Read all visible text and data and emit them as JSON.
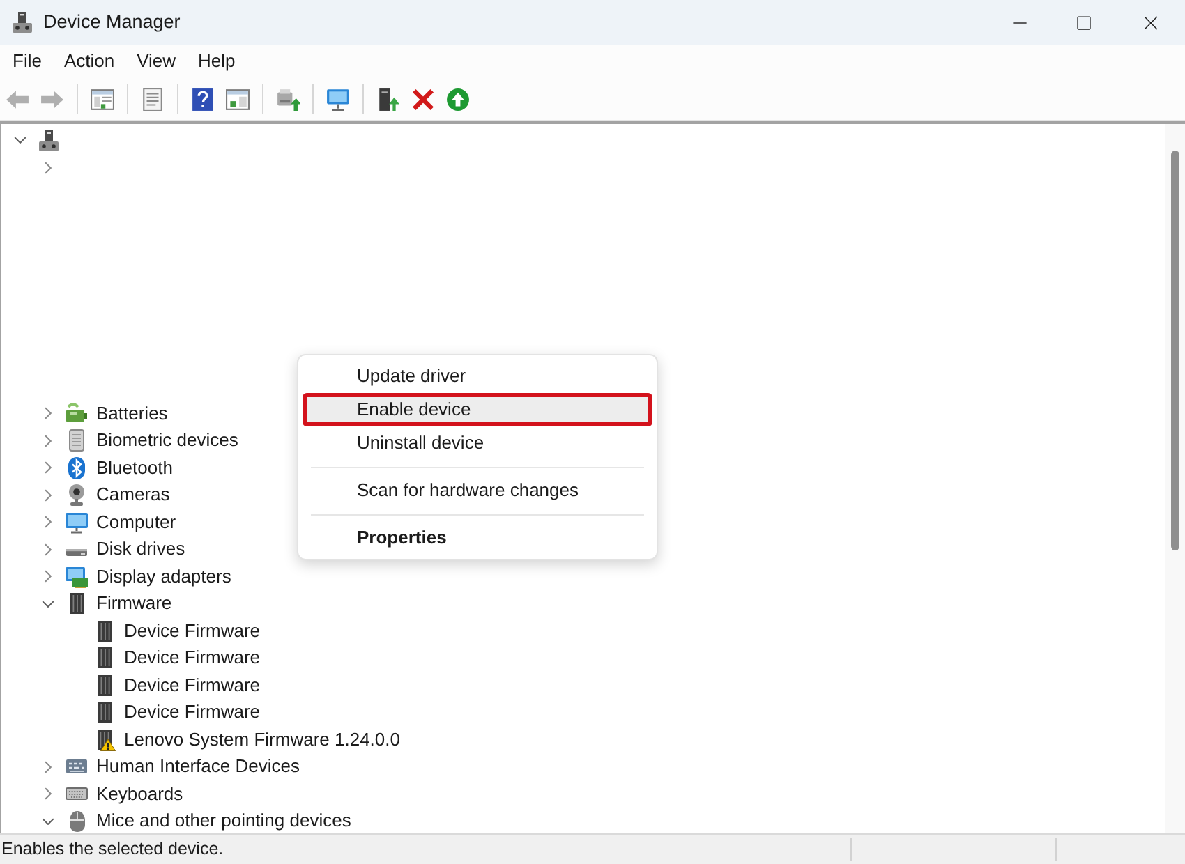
{
  "window": {
    "title": "Device Manager"
  },
  "menu_bar": [
    "File",
    "Action",
    "View",
    "Help"
  ],
  "toolbar": [
    {
      "kind": "back",
      "disabled": true
    },
    {
      "kind": "forward",
      "disabled": true
    },
    {
      "kind": "separator"
    },
    {
      "kind": "console",
      "disabled": false
    },
    {
      "kind": "separator"
    },
    {
      "kind": "properties",
      "disabled": false
    },
    {
      "kind": "separator"
    },
    {
      "kind": "help",
      "disabled": false
    },
    {
      "kind": "view",
      "disabled": false
    },
    {
      "kind": "separator"
    },
    {
      "kind": "scan",
      "disabled": false
    },
    {
      "kind": "separator"
    },
    {
      "kind": "monitor",
      "disabled": false
    },
    {
      "kind": "separator"
    },
    {
      "kind": "update",
      "disabled": false
    },
    {
      "kind": "uninstall",
      "disabled": false
    },
    {
      "kind": "enable",
      "disabled": false
    }
  ],
  "tree": {
    "root": {
      "kind": "pc",
      "expanded": true,
      "children": [
        {
          "expanded": false
        },
        {
          "kind": "batteries",
          "label": "Batteries",
          "expanded": false
        },
        {
          "kind": "biometric",
          "label": "Biometric devices",
          "expanded": false
        },
        {
          "kind": "bluetooth",
          "label": "Bluetooth",
          "expanded": false
        },
        {
          "kind": "cameras",
          "label": "Cameras",
          "expanded": false
        },
        {
          "kind": "computer",
          "label": "Computer",
          "expanded": false
        },
        {
          "kind": "disks",
          "label": "Disk drives",
          "expanded": false
        },
        {
          "kind": "display",
          "label": "Display adapters",
          "expanded": false
        },
        {
          "kind": "firmware",
          "label": "Firmware",
          "expanded": true,
          "children": [
            {
              "kind": "firmware",
              "label": "Device Firmware",
              "problem": false
            },
            {
              "kind": "firmware",
              "label": "Device Firmware",
              "problem": false
            },
            {
              "kind": "firmware",
              "label": "Device Firmware",
              "problem": false
            },
            {
              "kind": "firmware",
              "label": "Device Firmware",
              "problem": false
            },
            {
              "kind": "firmware",
              "label": "Lenovo System Firmware 1.24.0.0",
              "problem": true
            }
          ]
        },
        {
          "kind": "hid",
          "label": "Human Interface Devices",
          "expanded": false
        },
        {
          "kind": "keyboards",
          "label": "Keyboards",
          "expanded": false
        },
        {
          "kind": "mice",
          "label": "Mice and other pointing devices",
          "expanded": true
        }
      ]
    }
  },
  "context_menu": {
    "items": [
      {
        "kind": "item",
        "label": "Update driver",
        "selected": false,
        "outlined": false,
        "default": false
      },
      {
        "kind": "item",
        "label": "Enable device",
        "selected": true,
        "outlined": true,
        "default": false
      },
      {
        "kind": "item",
        "label": "Uninstall device",
        "selected": false,
        "outlined": false,
        "default": false
      },
      {
        "kind": "separator"
      },
      {
        "kind": "item",
        "label": "Scan for hardware changes",
        "selected": false,
        "outlined": false,
        "default": false
      },
      {
        "kind": "separator"
      },
      {
        "kind": "item",
        "label": "Properties",
        "selected": false,
        "outlined": false,
        "default": true
      }
    ]
  },
  "status_bar": {
    "text": "Enables the selected device."
  }
}
